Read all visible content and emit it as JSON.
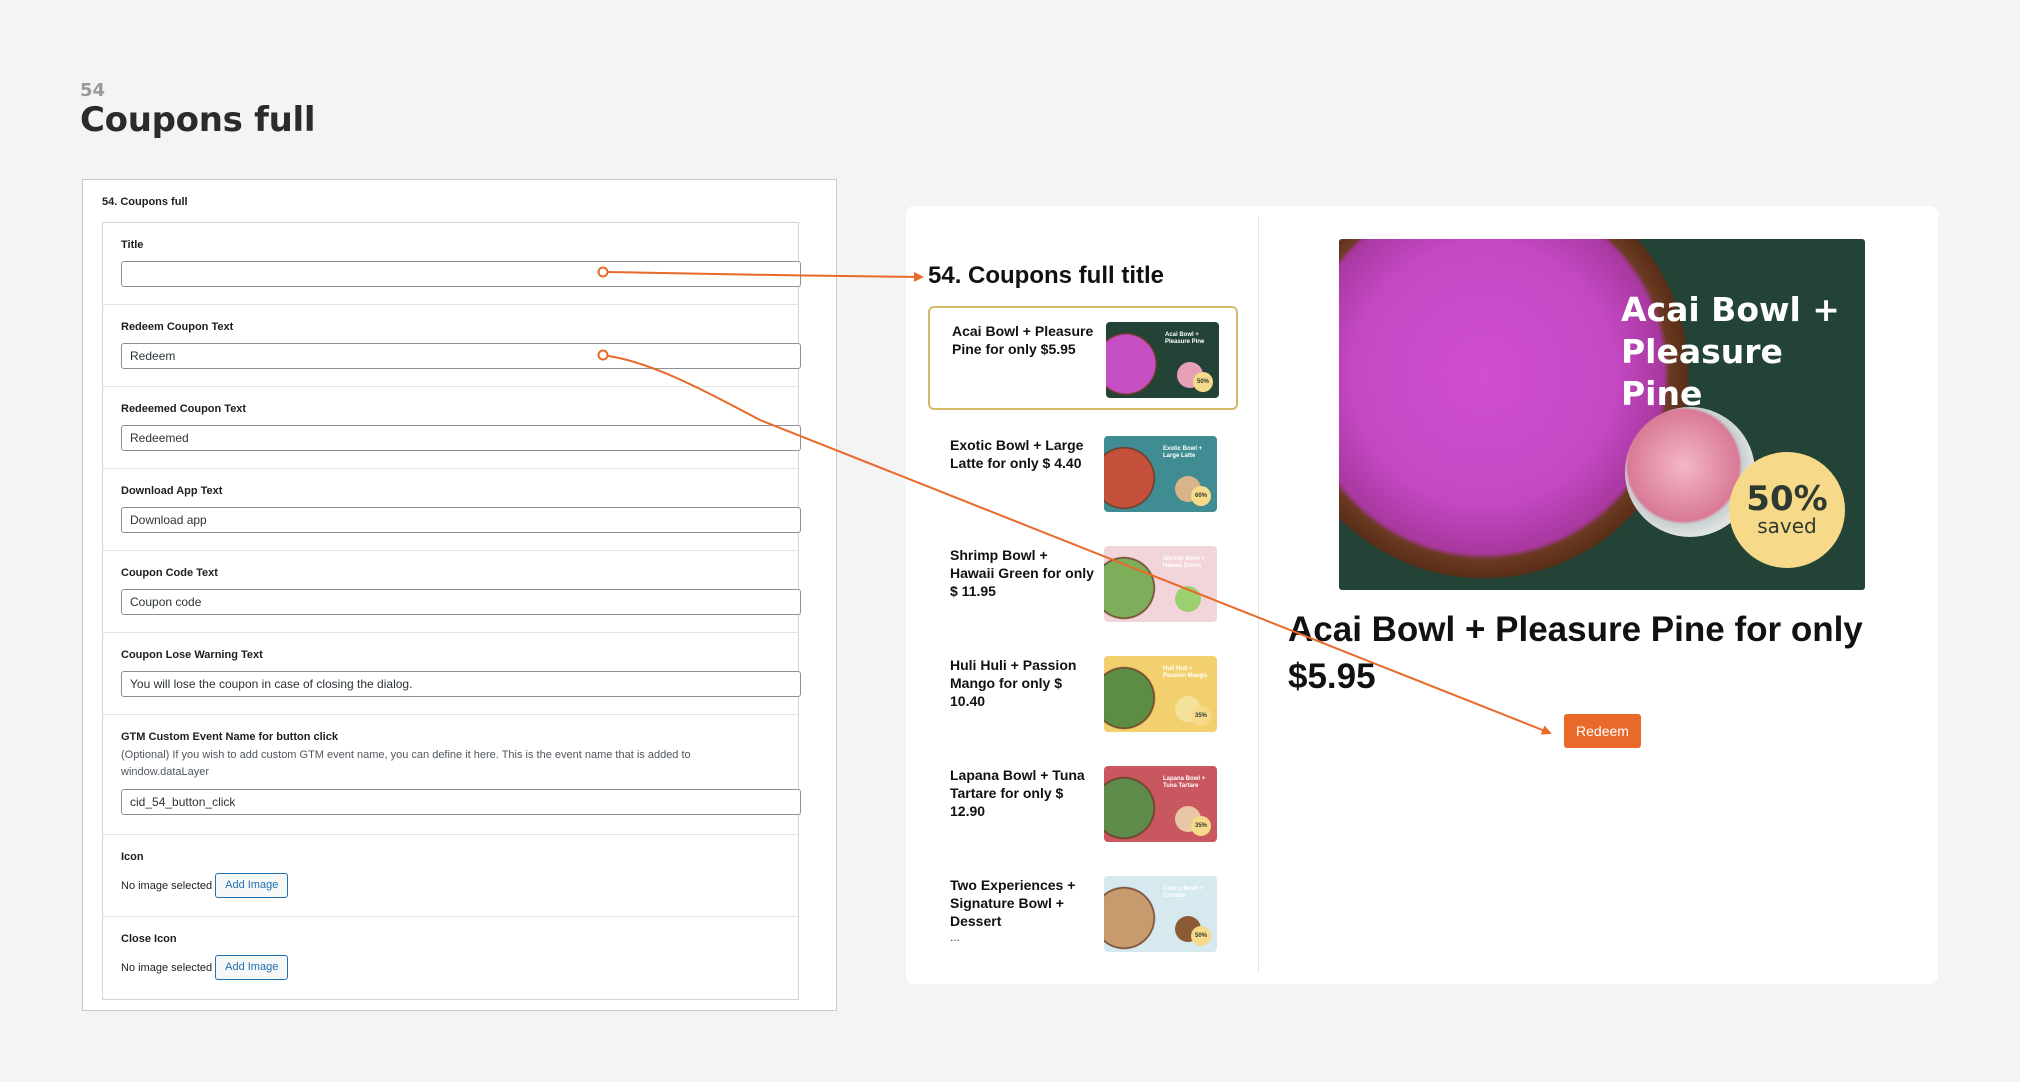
{
  "slide": {
    "number": "54",
    "title": "Coupons full"
  },
  "admin": {
    "heading": "54. Coupons full",
    "fields": [
      {
        "label": "Title",
        "value": ""
      },
      {
        "label": "Redeem Coupon Text",
        "value": "Redeem"
      },
      {
        "label": "Redeemed Coupon Text",
        "value": "Redeemed"
      },
      {
        "label": "Download App Text",
        "value": "Download app"
      },
      {
        "label": "Coupon Code Text",
        "value": "Coupon code"
      },
      {
        "label": "Coupon Lose Warning Text",
        "value": "You will lose the coupon in case of closing the dialog."
      },
      {
        "label": "GTM Custom Event Name for button click",
        "description": "(Optional) If you wish to add custom GTM event name, you can define it here. This is the event name that is added to window.dataLayer",
        "value": "cid_54_button_click"
      }
    ],
    "image_fields": [
      {
        "label": "Icon",
        "status": "No image selected",
        "button": "Add Image"
      },
      {
        "label": "Close Icon",
        "status": "No image selected",
        "button": "Add Image"
      }
    ]
  },
  "preview": {
    "title": "54. Coupons full title",
    "coupons": [
      {
        "text": "Acai Bowl + Pleasure Pine for only $5.95",
        "thumb_caption": "Acai Bowl + Pleasure Pine",
        "badge": "50%",
        "bg": "#234337",
        "bowl": "#c64fc4",
        "cup": "#e7a0b8"
      },
      {
        "text": "Exotic Bowl + Large Latte for only $ 4.40",
        "thumb_caption": "Exotic Bowl + Large Latte",
        "badge": "60%",
        "bg": "#3f8c93",
        "bowl": "#c5503c",
        "cup": "#d9b48a"
      },
      {
        "text": "Shrimp Bowl + Hawaii Green for only $ 11.95",
        "thumb_caption": "Shrimp Bowl + Hawaii Green",
        "badge": "",
        "bg": "#f2d5db",
        "bowl": "#7fae5a",
        "cup": "#9ccf6f"
      },
      {
        "text": "Huli Huli + Passion Mango for only $ 10.40",
        "thumb_caption": "Huli Huli + Passion Mango",
        "badge": "35%",
        "bg": "#f3d06e",
        "bowl": "#5d8d45",
        "cup": "#f5e29a"
      },
      {
        "text": "Lapana Bowl + Tuna Tartare for only $ 12.90",
        "thumb_caption": "Lapana Bowl + Tuna Tartare",
        "badge": "35%",
        "bg": "#c9575f",
        "bowl": "#5e8a4a",
        "cup": "#e9c7a4"
      },
      {
        "text": "Two Experiences + Signature Bowl + Dessert",
        "ellipsis": "...",
        "thumb_caption": "Choco Bowl + Cortado",
        "badge": "50%",
        "bg": "#d6e9ee",
        "bowl": "#c79b6d",
        "cup": "#8b5a36"
      }
    ],
    "hero": {
      "caption_line1": "Acai Bowl +",
      "caption_line2": "Pleasure Pine",
      "badge_pct": "50%",
      "badge_label": "saved"
    },
    "selected_title": "Acai Bowl + Pleasure Pine for only $5.95",
    "redeem_button": "Redeem"
  },
  "colors": {
    "accent": "#e8692a",
    "selected_border": "#d6b86a",
    "link_blue": "#2271b1"
  }
}
